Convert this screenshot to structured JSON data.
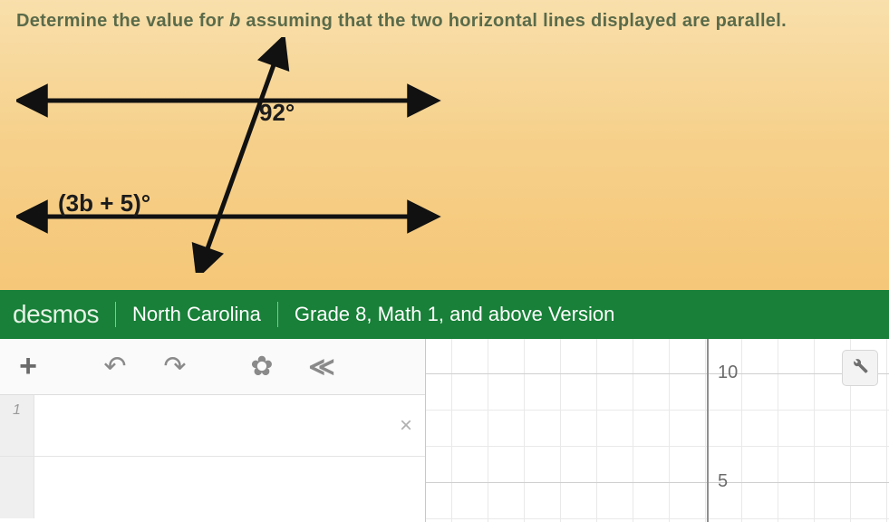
{
  "question": {
    "prefix": "Determine the value for ",
    "variable": "b",
    "suffix": " assuming that the two horizontal lines displayed are parallel."
  },
  "figure": {
    "angle1": "92°",
    "angle2": "(3b + 5)°"
  },
  "desmos": {
    "logo": "desmos",
    "region": "North Carolina",
    "version": "Grade 8, Math 1, and above Version"
  },
  "tools": {
    "add": "+",
    "undo": "↶",
    "redo": "↷",
    "settings": "✿",
    "collapse": "≪"
  },
  "expression": {
    "row1_index": "1",
    "delete": "×"
  },
  "graph": {
    "tick10": "10",
    "tick5": "5",
    "wrench": "🔧"
  },
  "chart_data": {
    "type": "line",
    "title": "",
    "xlabel": "",
    "ylabel": "",
    "ylim": [
      0,
      12
    ],
    "ticks_y": [
      5,
      10
    ],
    "series": []
  }
}
